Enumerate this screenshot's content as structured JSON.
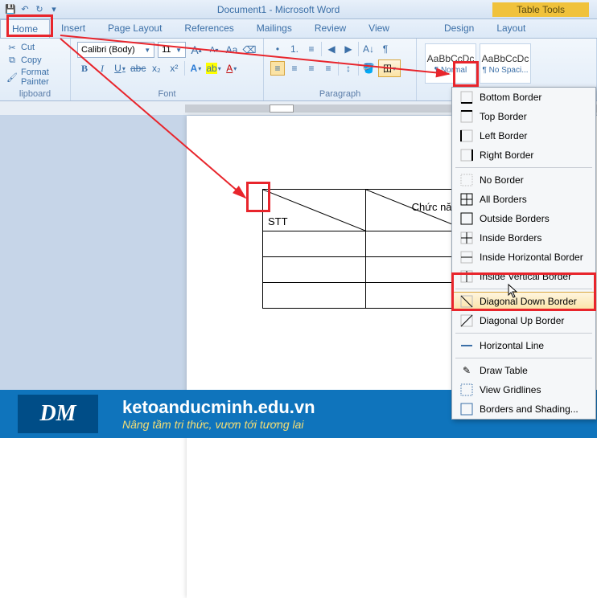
{
  "title": "Document1 - Microsoft Word",
  "qat": {
    "save": "💾",
    "undo": "↶",
    "redo": "↻",
    "more": "▾"
  },
  "table_tools": "Table Tools",
  "tabs": {
    "home": "Home",
    "insert": "Insert",
    "page_layout": "Page Layout",
    "references": "References",
    "mailings": "Mailings",
    "review": "Review",
    "view": "View",
    "design": "Design",
    "layout": "Layout"
  },
  "clipboard": {
    "cut": "Cut",
    "copy": "Copy",
    "format_painter": "Format Painter",
    "label": "lipboard"
  },
  "font": {
    "name": "Calibri (Body)",
    "size": "11",
    "grow": "A",
    "shrink": "A",
    "case": "Aa",
    "clear": "⌫",
    "b": "B",
    "i": "I",
    "u": "U",
    "s": "abc",
    "sub": "x₂",
    "sup": "x²",
    "effects": "A",
    "highlight": "ab",
    "color": "A",
    "label": "Font"
  },
  "para": {
    "bullets": "•",
    "numbering": "1.",
    "multilevel": "≡",
    "dec_indent": "◀",
    "inc_indent": "▶",
    "sort": "A↓",
    "showmarks": "¶",
    "align_left": "≡",
    "align_center": "≡",
    "align_right": "≡",
    "justify": "≡",
    "line_spacing": "↕",
    "shading": "🪣",
    "borders": "田",
    "label": "Paragraph"
  },
  "styles": {
    "preview": "AaBbCcDc",
    "normal": "¶ Normal",
    "no_spacing": "¶ No Spaci..."
  },
  "table": {
    "col1": "STT",
    "col2": "Chức năng"
  },
  "border_menu": {
    "bottom": "Bottom Border",
    "top": "Top Border",
    "left": "Left Border",
    "right": "Right Border",
    "no": "No Border",
    "all": "All Borders",
    "outside": "Outside Borders",
    "inside": "Inside Borders",
    "inside_h": "Inside Horizontal Border",
    "inside_v": "Inside Vertical Border",
    "diag_down": "Diagonal Down Border",
    "diag_up": "Diagonal Up Border",
    "hline": "Horizontal Line",
    "draw": "Draw Table",
    "gridlines": "View Gridlines",
    "shading": "Borders and Shading..."
  },
  "footer": {
    "logo": "DM",
    "url": "ketoanducminh.edu.vn",
    "slogan": "Nâng tầm tri thức, vươn tới tương lai"
  },
  "colors": {
    "red": "#e8252c",
    "blue": "#0f74bc",
    "gold": "#f6de74"
  }
}
